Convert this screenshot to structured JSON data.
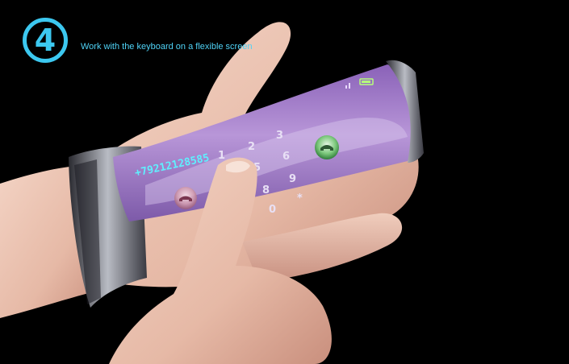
{
  "step": {
    "number": "4"
  },
  "caption": "Work with the keyboard on a flexible screen",
  "device": {
    "phone_number": "+79212128585",
    "keys": [
      "1",
      "2",
      "3",
      "5",
      "6",
      "8",
      "9",
      "+",
      "0",
      "*"
    ],
    "icons": [
      "call-icon",
      "hangup-icon",
      "battery-icon",
      "signal-icon"
    ]
  }
}
